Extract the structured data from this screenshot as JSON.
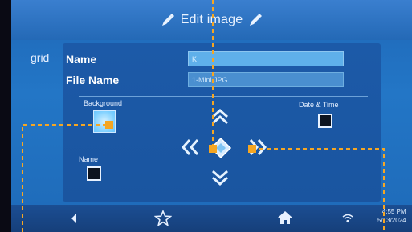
{
  "header": {
    "title": "Edit image"
  },
  "side": {
    "label": "grid"
  },
  "form": {
    "name_label": "Name",
    "name_value": "K",
    "file_label": "File Name",
    "file_value": "1-Mini.JPG",
    "background_label": "Background",
    "datetime_label": "Date & Time",
    "name_toggle_label": "Name"
  },
  "statusbar": {
    "time": "4:55 PM",
    "date": "5/13/2024"
  },
  "icons": [
    "pencil-icon",
    "chevron-up-icon",
    "chevron-down-icon",
    "chevron-left-icon",
    "chevron-right-icon",
    "center-icon",
    "back-icon",
    "star-icon",
    "home-icon",
    "wifi-icon"
  ],
  "colors": {
    "accent": "#f5a623",
    "screen": "#2376c6"
  }
}
